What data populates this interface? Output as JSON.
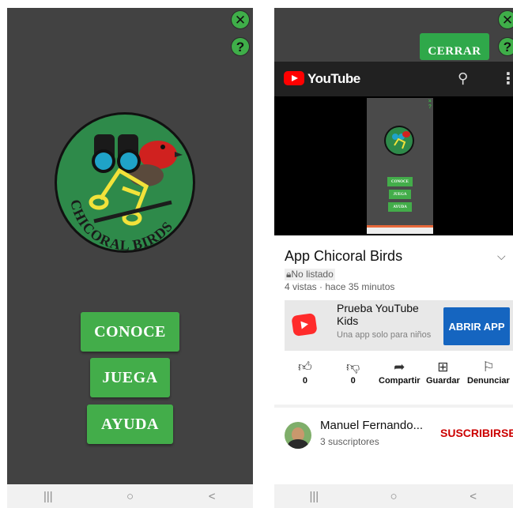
{
  "left_screen": {
    "logo_text": "CHICORAL BIRDS",
    "menu": [
      {
        "label": "CONOCE"
      },
      {
        "label": "JUEGA"
      },
      {
        "label": "AYUDA"
      }
    ],
    "close_glyph": "✕",
    "help_glyph": "?"
  },
  "right_screen": {
    "close_button_label": "CERRAR",
    "close_glyph": "✕",
    "help_glyph": "?",
    "youtube": {
      "brand": "YouTube",
      "video_preview": {
        "buttons": [
          "CONOCE",
          "JUEGA",
          "AYUDA"
        ]
      },
      "video_title": "App Chicoral Birds",
      "visibility": "No listado",
      "meta": "4 vistas · hace 35 minutos",
      "promo": {
        "title": "Prueba YouTube Kids",
        "subtitle": "Una app solo para niños",
        "button": "ABRIR APP"
      },
      "actions": [
        {
          "label": "0",
          "icon": "thumb-up-icon"
        },
        {
          "label": "0",
          "icon": "thumb-down-icon"
        },
        {
          "label": "Compartir",
          "icon": "share-icon"
        },
        {
          "label": "Guardar",
          "icon": "save-icon"
        },
        {
          "label": "Denunciar",
          "icon": "flag-icon"
        }
      ],
      "channel": {
        "name": "Manuel Fernando...",
        "subscribers": "3 suscriptores",
        "subscribe": "SUSCRIBIRSE"
      }
    }
  },
  "nav_bar": {
    "recents": "|||",
    "home": "○",
    "back": "<"
  },
  "colors": {
    "app_background": "#424242",
    "app_green": "#43ad4a",
    "youtube_red": "#ff0000",
    "subscribe_red": "#cc0000",
    "open_app_blue": "#1565c0"
  }
}
